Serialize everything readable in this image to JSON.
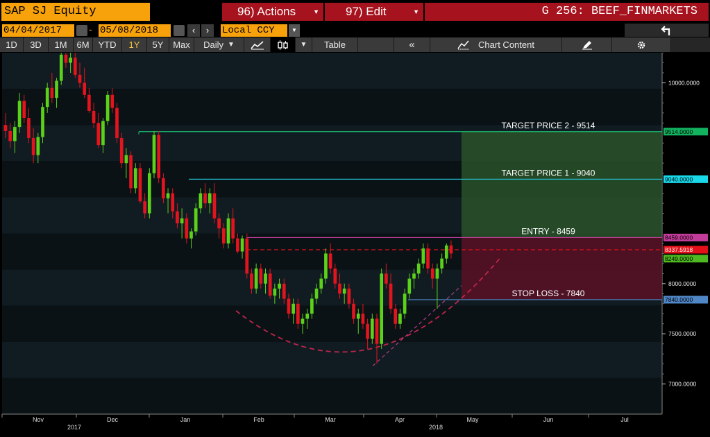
{
  "toolbar": {
    "ticker": "SAP SJ Equity",
    "actions_label": "96) Actions",
    "edit_label": "97) Edit",
    "page_title": "G 256: BEEF_FINMARKETS",
    "start_date": "04/04/2017",
    "end_date": "05/08/2018",
    "currency": "Local CCY",
    "back_icon": "back-arrow-icon",
    "periods": [
      "1D",
      "3D",
      "1M",
      "6M",
      "YTD",
      "1Y",
      "5Y",
      "Max"
    ],
    "active_period": "1Y",
    "frequency": "Daily",
    "line_icon": "line-chart-icon",
    "candle_icon": "candlestick-icon",
    "table_label": "Table",
    "collapse_label": "«",
    "chart_content_label": "Chart Content",
    "chart_content_icon": "chart-content-icon",
    "annotate_icon": "edit-icon",
    "settings_icon": "gear-icon"
  },
  "chart_data": {
    "type": "candlestick",
    "x_tick_labels": [
      "Nov",
      "Dec",
      "Jan",
      "Feb",
      "Mar",
      "Apr",
      "May",
      "Jun",
      "Jul"
    ],
    "year_labels": [
      {
        "label": "2017",
        "after": "Nov"
      },
      {
        "label": "2018",
        "after": "Apr"
      }
    ],
    "y_tick_labels": [
      "10000.0000",
      "8000.0000",
      "7500.0000",
      "7000.0000"
    ],
    "y_ticks": [
      10000,
      8000,
      7500,
      7000
    ],
    "ylim": [
      6700,
      10300
    ],
    "x_months": [
      "Nov",
      "Dec",
      "Jan",
      "Feb",
      "Mar",
      "Apr",
      "May",
      "Jun",
      "Jul"
    ],
    "series": [
      {
        "values": [
          [
            9580,
            9700,
            9450,
            9520
          ],
          [
            9520,
            9600,
            9350,
            9420
          ],
          [
            9420,
            9620,
            9300,
            9560
          ],
          [
            9560,
            9900,
            9500,
            9820
          ],
          [
            9820,
            9880,
            9600,
            9650
          ],
          [
            9650,
            9750,
            9400,
            9450
          ],
          [
            9450,
            9550,
            9200,
            9280
          ],
          [
            9280,
            9500,
            9200,
            9460
          ],
          [
            9460,
            9800,
            9400,
            9760
          ],
          [
            9760,
            10000,
            9700,
            9950
          ],
          [
            9950,
            10100,
            9800,
            9850
          ],
          [
            9850,
            10050,
            9750,
            10020
          ],
          [
            10020,
            10350,
            9980,
            10280
          ],
          [
            10280,
            10350,
            10150,
            10200
          ],
          [
            10200,
            10320,
            10100,
            10250
          ],
          [
            10250,
            10300,
            10050,
            10080
          ],
          [
            10080,
            10200,
            9950,
            10000
          ],
          [
            10000,
            10150,
            9850,
            9880
          ],
          [
            9880,
            9950,
            9700,
            9720
          ],
          [
            9720,
            9800,
            9550,
            9600
          ],
          [
            9600,
            9700,
            9350,
            9380
          ],
          [
            9380,
            9650,
            9300,
            9620
          ],
          [
            9620,
            9920,
            9580,
            9880
          ],
          [
            9880,
            9950,
            9700,
            9750
          ],
          [
            9750,
            9800,
            9400,
            9450
          ],
          [
            9450,
            9500,
            9150,
            9200
          ],
          [
            9200,
            9350,
            9050,
            9280
          ],
          [
            9280,
            9320,
            8900,
            8950
          ],
          [
            8950,
            9200,
            8900,
            9150
          ],
          [
            9150,
            9200,
            8800,
            8820
          ],
          [
            8820,
            8900,
            8650,
            8700
          ],
          [
            8700,
            9150,
            8650,
            9100
          ],
          [
            9100,
            9520,
            9050,
            9480
          ],
          [
            9480,
            9520,
            9000,
            9050
          ],
          [
            9050,
            9100,
            8800,
            8850
          ],
          [
            8850,
            8950,
            8700,
            8900
          ],
          [
            8900,
            8950,
            8650,
            8720
          ],
          [
            8720,
            8800,
            8550,
            8600
          ],
          [
            8600,
            8750,
            8450,
            8650
          ],
          [
            8650,
            8700,
            8400,
            8450
          ],
          [
            8450,
            8550,
            8350,
            8520
          ],
          [
            8520,
            8800,
            8480,
            8750
          ],
          [
            8750,
            8950,
            8700,
            8900
          ],
          [
            8900,
            9000,
            8750,
            8800
          ],
          [
            8800,
            8950,
            8700,
            8900
          ],
          [
            8900,
            9000,
            8600,
            8650
          ],
          [
            8650,
            8700,
            8450,
            8550
          ],
          [
            8550,
            8600,
            8350,
            8400
          ],
          [
            8400,
            8700,
            8350,
            8650
          ],
          [
            8650,
            8750,
            8400,
            8450
          ],
          [
            8450,
            8500,
            8300,
            8320
          ],
          [
            8320,
            8480,
            8250,
            8450
          ],
          [
            8450,
            8500,
            8050,
            8100
          ],
          [
            8100,
            8150,
            7900,
            7950
          ],
          [
            7950,
            8200,
            7900,
            8150
          ],
          [
            8150,
            8200,
            7950,
            8000
          ],
          [
            8000,
            8150,
            7900,
            8100
          ],
          [
            8100,
            8150,
            7850,
            7880
          ],
          [
            7880,
            8000,
            7800,
            7950
          ],
          [
            7950,
            8050,
            7850,
            8000
          ],
          [
            8000,
            8050,
            7800,
            7850
          ],
          [
            7850,
            7900,
            7650,
            7700
          ],
          [
            7700,
            7850,
            7600,
            7800
          ],
          [
            7800,
            7850,
            7550,
            7600
          ],
          [
            7600,
            7700,
            7500,
            7650
          ],
          [
            7650,
            7750,
            7550,
            7700
          ],
          [
            7700,
            7900,
            7650,
            7850
          ],
          [
            7850,
            8000,
            7800,
            7950
          ],
          [
            7950,
            8100,
            7900,
            8050
          ],
          [
            8050,
            8350,
            8000,
            8300
          ],
          [
            8300,
            8400,
            8100,
            8150
          ],
          [
            8150,
            8200,
            7950,
            8000
          ],
          [
            8000,
            8100,
            7850,
            7900
          ],
          [
            7900,
            8000,
            7800,
            7950
          ],
          [
            7950,
            8000,
            7750,
            7800
          ],
          [
            7800,
            7850,
            7600,
            7650
          ],
          [
            7650,
            7750,
            7500,
            7700
          ],
          [
            7700,
            7800,
            7550,
            7600
          ],
          [
            7600,
            7650,
            7350,
            7450
          ],
          [
            7450,
            7700,
            7400,
            7650
          ],
          [
            7650,
            7700,
            7200,
            7400
          ],
          [
            7400,
            8150,
            7350,
            8100
          ],
          [
            8100,
            8200,
            7950,
            8000
          ],
          [
            8000,
            8100,
            7700,
            7750
          ],
          [
            7750,
            7800,
            7550,
            7600
          ],
          [
            7600,
            7750,
            7550,
            7700
          ],
          [
            7700,
            7950,
            7650,
            7900
          ],
          [
            7900,
            8100,
            7850,
            8050
          ],
          [
            8050,
            8150,
            7950,
            8100
          ],
          [
            8100,
            8250,
            8050,
            8200
          ],
          [
            8200,
            8400,
            8150,
            8350
          ],
          [
            8350,
            8400,
            8100,
            8150
          ],
          [
            8150,
            8200,
            7950,
            8050
          ],
          [
            8050,
            8200,
            7750,
            8150
          ],
          [
            8150,
            8300,
            8100,
            8250
          ],
          [
            8250,
            8400,
            8200,
            8380
          ],
          [
            8380,
            8430,
            8250,
            8300
          ]
        ]
      }
    ],
    "levels": [
      {
        "label": "TARGET PRICE 2 - 9514",
        "value": 9514,
        "tag": "9514.0000",
        "color": "#1bbf73",
        "tag_bg": "#12b35f"
      },
      {
        "label": "TARGET PRICE 1 - 9040",
        "value": 9040,
        "tag": "9040.0000",
        "color": "#22b8c8",
        "tag_bg": "#18d8ea"
      },
      {
        "label": "ENTRY - 8459",
        "value": 8459,
        "tag": "8459.0000",
        "color": "#c43c9a",
        "tag_bg": "#c43c9a"
      },
      {
        "label": "STOP LOSS - 7840",
        "value": 7840,
        "tag": "7840.0000",
        "color": "#4f86c6",
        "tag_bg": "#4f86c6"
      }
    ],
    "last_price": {
      "value": 8337.5918,
      "tag": "8337.5918",
      "color": "#e3101a"
    },
    "low_tag": {
      "value": 8249,
      "tag": "8249.0000",
      "color": "#4db81f"
    },
    "colors": {
      "up": "#5cd11a",
      "down": "#e3141e",
      "target_zone": "#2e5a2b",
      "stop_zone": "#5a1026",
      "pattern": "#c0254a"
    }
  }
}
